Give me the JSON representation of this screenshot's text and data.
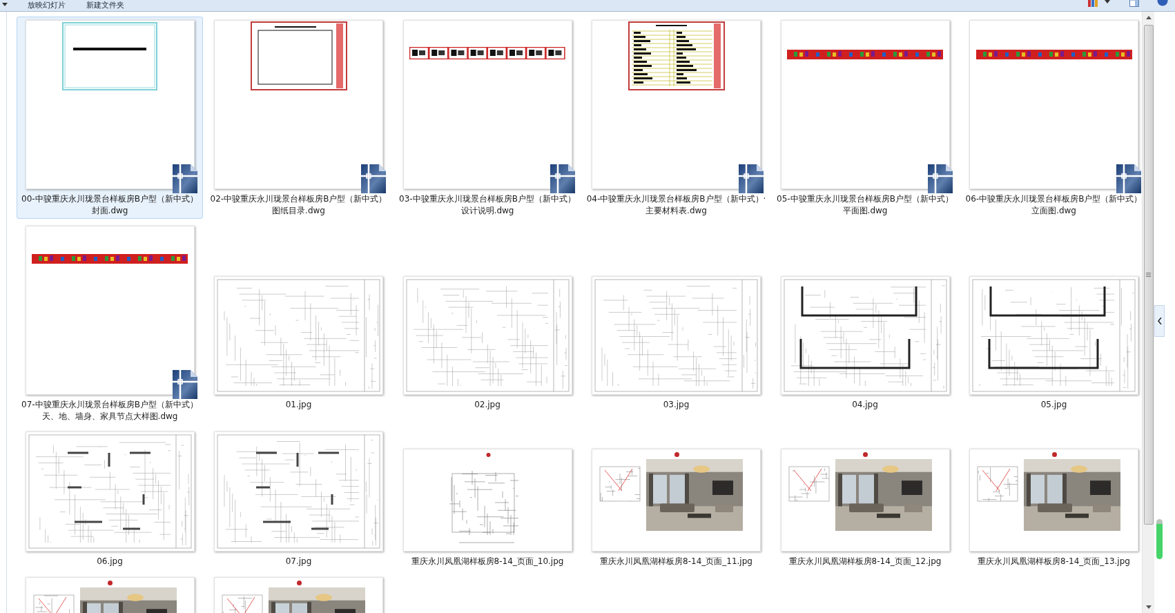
{
  "toolbar": {
    "buttons": [
      "放映幻灯片",
      "新建文件夹"
    ]
  },
  "files": [
    {
      "name_lines": [
        "00-中骏重庆永川珑景台样板房B户型（新中式）",
        "封面.dwg"
      ],
      "kind": "dwg-cover",
      "selected": true
    },
    {
      "name_lines": [
        "02-中骏重庆永川珑景台样板房B户型（新中式）",
        "图纸目录.dwg"
      ],
      "kind": "dwg-index",
      "selected": false
    },
    {
      "name_lines": [
        "03-中骏重庆永川珑景台样板房B户型（新中式）",
        "设计说明.dwg"
      ],
      "kind": "dwg-strip",
      "selected": false
    },
    {
      "name_lines": [
        "04-中骏重庆永川珑景台样板房B户型（新中式）·",
        "主要材料表.dwg"
      ],
      "kind": "dwg-table",
      "selected": false
    },
    {
      "name_lines": [
        "05-中骏重庆永川珑景台样板房B户型（新中式）",
        "平面图.dwg"
      ],
      "kind": "dwg-colorstrip",
      "selected": false
    },
    {
      "name_lines": [
        "06-中骏重庆永川珑景台样板房B户型（新中式）",
        "立面图.dwg"
      ],
      "kind": "dwg-colorstrip",
      "selected": false
    },
    {
      "name_lines": [
        "07-中骏重庆永川珑景台样板房B户型（新中式）",
        "天、地、墙身、家具节点大样图.dwg"
      ],
      "kind": "dwg-colorstrip",
      "selected": false
    },
    {
      "name_lines": [
        "01.jpg"
      ],
      "kind": "jpg-sheet",
      "selected": false
    },
    {
      "name_lines": [
        "02.jpg"
      ],
      "kind": "jpg-sheet",
      "selected": false
    },
    {
      "name_lines": [
        "03.jpg"
      ],
      "kind": "jpg-sheet",
      "selected": false
    },
    {
      "name_lines": [
        "04.jpg"
      ],
      "kind": "jpg-elevation",
      "selected": false
    },
    {
      "name_lines": [
        "05.jpg"
      ],
      "kind": "jpg-elevation",
      "selected": false
    },
    {
      "name_lines": [
        "06.jpg"
      ],
      "kind": "jpg-plan",
      "selected": false
    },
    {
      "name_lines": [
        "07.jpg"
      ],
      "kind": "jpg-plan",
      "selected": false
    },
    {
      "name_lines": [
        "重庆永川凤凰湖样板房8-14_页面_10.jpg"
      ],
      "kind": "jpg-planpage",
      "selected": false
    },
    {
      "name_lines": [
        "重庆永川凤凰湖样板房8-14_页面_11.jpg"
      ],
      "kind": "jpg-render",
      "selected": false
    },
    {
      "name_lines": [
        "重庆永川凤凰湖样板房8-14_页面_12.jpg"
      ],
      "kind": "jpg-render",
      "selected": false
    },
    {
      "name_lines": [
        "重庆永川凤凰湖样板房8-14_页面_13.jpg"
      ],
      "kind": "jpg-render",
      "selected": false
    },
    {
      "kind": "jpg-render",
      "selected": false
    },
    {
      "kind": "jpg-render",
      "selected": false
    }
  ]
}
